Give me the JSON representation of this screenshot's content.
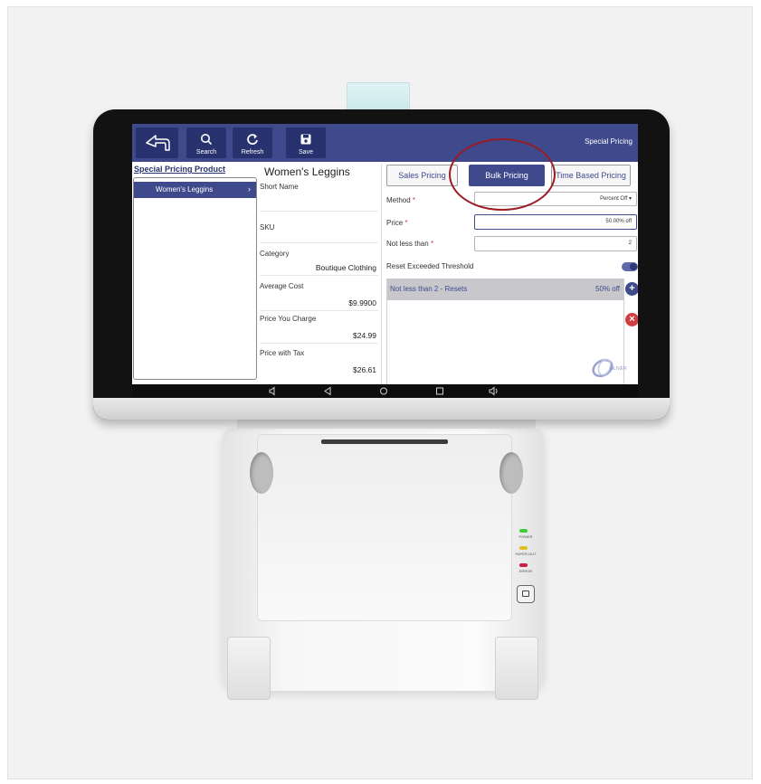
{
  "colors": {
    "primary": "#3f4a8c",
    "primary_dark": "#28326e",
    "required": "#d43a3a",
    "remove": "#d04040",
    "annotation": "#9b1b23"
  },
  "toolbar": {
    "back_icon": "back-arrow-icon",
    "search_label": "Search",
    "refresh_label": "Refresh",
    "save_label": "Save",
    "title": "Special Pricing"
  },
  "product_list": {
    "title": "Special Pricing Product",
    "items": [
      {
        "label": "Women's Leggins",
        "chevron": "›"
      }
    ]
  },
  "product_details": {
    "title": "Women's Leggins",
    "fields": [
      {
        "label": "Short Name",
        "value": ""
      },
      {
        "label": "SKU",
        "value": ""
      },
      {
        "label": "Category",
        "value": "Boutique Clothing"
      },
      {
        "label": "Average Cost",
        "value": "$9.9900"
      },
      {
        "label": "Price You Charge",
        "value": "$24.99"
      },
      {
        "label": "Price with Tax",
        "value": "$26.61"
      }
    ]
  },
  "pricing": {
    "tabs": [
      {
        "label": "Sales Pricing",
        "active": false
      },
      {
        "label": "Bulk Pricing",
        "active": true
      },
      {
        "label": "Time Based Pricing",
        "active": false
      }
    ],
    "method": {
      "label": "Method",
      "required_mark": "*",
      "value": "Percent Off",
      "caret": "▾"
    },
    "price": {
      "label": "Price",
      "required_mark": "*",
      "value": "50.00% off"
    },
    "not_less_than": {
      "label": "Not less than",
      "required_mark": "*",
      "value": "2"
    },
    "reset_threshold": {
      "label": "Reset Exceeded Threshold",
      "enabled": true
    },
    "rules": [
      {
        "label": "Not less than 2 - Resets",
        "value": "50% off"
      }
    ],
    "add_button": "+",
    "remove_button": "×"
  },
  "logo": {
    "text": "OLIVER"
  },
  "printer": {
    "leds": [
      {
        "label": "POWER",
        "color": "#3ccf3c"
      },
      {
        "label": "PAPER-OUT",
        "color": "#e0c020"
      },
      {
        "label": "ERROR",
        "color": "#d02040"
      }
    ]
  },
  "navbar": {
    "icons": [
      "volume-down-icon",
      "back-triangle-icon",
      "home-circle-icon",
      "recents-square-icon",
      "volume-up-icon"
    ]
  }
}
